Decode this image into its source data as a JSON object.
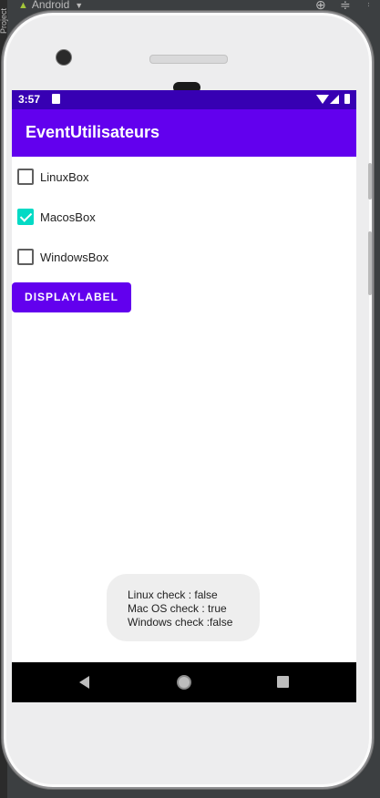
{
  "ide": {
    "device_label": "Android",
    "side_tab": "Project"
  },
  "status_bar": {
    "time": "3:57"
  },
  "app_bar": {
    "title": "EventUtilisateurs"
  },
  "checkboxes": [
    {
      "label": "LinuxBox",
      "checked": false
    },
    {
      "label": "MacosBox",
      "checked": true
    },
    {
      "label": "WindowsBox",
      "checked": false
    }
  ],
  "button": {
    "label": "DISPLAYLABEL"
  },
  "toast": {
    "lines": [
      "Linux check : false",
      "Mac OS check : true",
      "Windows check :false"
    ]
  },
  "colors": {
    "status_bar": "#3700b3",
    "primary": "#6200ee",
    "checkbox_accent": "#03dac5"
  }
}
